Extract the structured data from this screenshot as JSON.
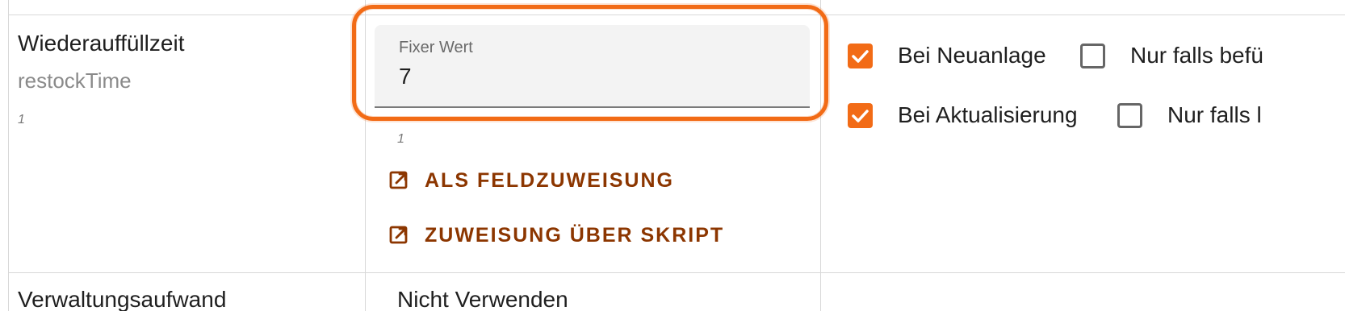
{
  "field": {
    "label": "Wiederauffüllzeit",
    "key": "restockTime",
    "count": "1"
  },
  "input": {
    "label": "Fixer Wert",
    "value": "7",
    "count": "1"
  },
  "actions": [
    {
      "label": "ALS FELDZUWEISUNG",
      "icon": "open-in-new-icon"
    },
    {
      "label": "ZUWEISUNG ÜBER SKRIPT",
      "icon": "open-in-new-icon"
    }
  ],
  "options": {
    "row1": {
      "primary": {
        "label": "Bei Neuanlage",
        "checked": true
      },
      "secondary": {
        "label": "Nur falls befü",
        "checked": false
      }
    },
    "row2": {
      "primary": {
        "label": "Bei Aktualisierung",
        "checked": true
      },
      "secondary": {
        "label": "Nur falls l",
        "checked": false
      }
    }
  },
  "next_row": {
    "label_clipped": "Verwaltungsaufwand",
    "value_clipped": "Nicht Verwenden"
  },
  "colors": {
    "accent": "#f26b16",
    "action_text": "#8c3600",
    "grid": "#d8d8d8",
    "input_bg": "#f3f3f3"
  }
}
